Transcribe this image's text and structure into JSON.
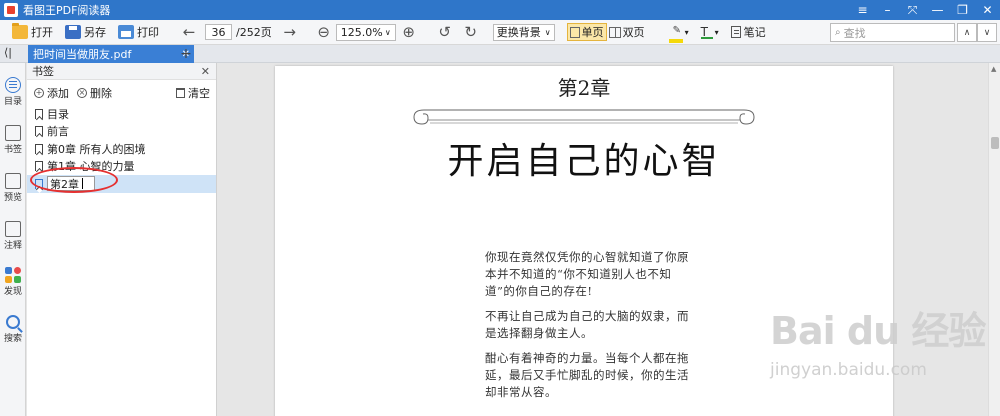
{
  "window": {
    "title": "看图王PDF阅读器"
  },
  "toolbar": {
    "open": "打开",
    "save_as": "另存",
    "print": "打印",
    "current_page": "36",
    "total_pages": "/252页",
    "zoom": "125.0%",
    "background_dropdown": "更换背景",
    "single_page": "单页",
    "double_page": "双页",
    "highlight_color": "#f5d90a",
    "text_color": "#2e9b3d",
    "notes": "笔记",
    "search_placeholder": "查找"
  },
  "tabs": {
    "active_file": "把时间当做朋友.pdf"
  },
  "sidebar": {
    "items": [
      {
        "label": "目录"
      },
      {
        "label": "书签"
      },
      {
        "label": "预览"
      },
      {
        "label": "注释"
      },
      {
        "label": "发现"
      },
      {
        "label": "搜索"
      }
    ]
  },
  "bookmarks": {
    "title": "书签",
    "add": "添加",
    "delete": "删除",
    "clear": "清空",
    "items": [
      {
        "label": "目录"
      },
      {
        "label": "前言"
      },
      {
        "label": "第0章 所有人的困境"
      },
      {
        "label": "第1章 心智的力量"
      }
    ],
    "editing_value": "第2章"
  },
  "document": {
    "chapter_number": "第2章",
    "chapter_title": "开启自己的心智",
    "paragraphs": [
      "你现在竟然仅凭你的心智就知道了你原本并不知道的“你不知道别人也不知道”的你自己的存在!",
      "不再让自己成为自己的大脑的奴隶，而是选择翻身做主人。",
      "酣心有着神奇的力量。当每个人都在拖延，最后又手忙脚乱的时候，你的生活却非常从容。"
    ]
  },
  "watermark": {
    "main": "Bai du 经验",
    "sub": "jingyan.baidu.com"
  }
}
